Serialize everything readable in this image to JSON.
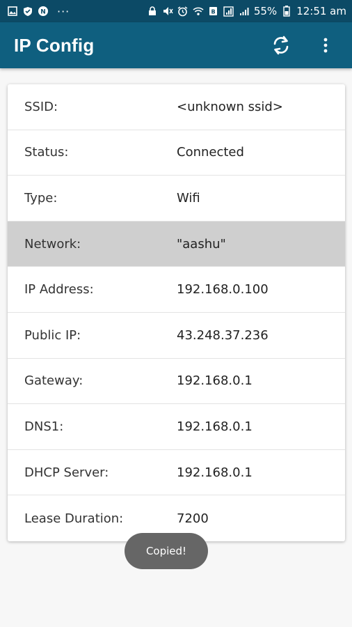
{
  "status_bar": {
    "battery": "55%",
    "time": "12:51 am",
    "dots": "···"
  },
  "app_bar": {
    "title": "IP Config"
  },
  "rows": [
    {
      "label": "SSID:",
      "value": "<unknown ssid>"
    },
    {
      "label": "Status:",
      "value": "Connected"
    },
    {
      "label": "Type:",
      "value": "Wifi"
    },
    {
      "label": "Network:",
      "value": "\"aashu\""
    },
    {
      "label": "IP Address:",
      "value": "192.168.0.100"
    },
    {
      "label": "Public IP:",
      "value": "43.248.37.236"
    },
    {
      "label": "Gateway:",
      "value": "192.168.0.1"
    },
    {
      "label": "DNS1:",
      "value": "192.168.0.1"
    },
    {
      "label": "DHCP Server:",
      "value": "192.168.0.1"
    },
    {
      "label": "Lease Duration:",
      "value": "7200"
    }
  ],
  "toast": "Copied!",
  "colors": {
    "status_bar": "#0c4a66",
    "app_bar": "#0f5f7f",
    "selected_row": "#cfcfcf",
    "toast": "#666666"
  }
}
